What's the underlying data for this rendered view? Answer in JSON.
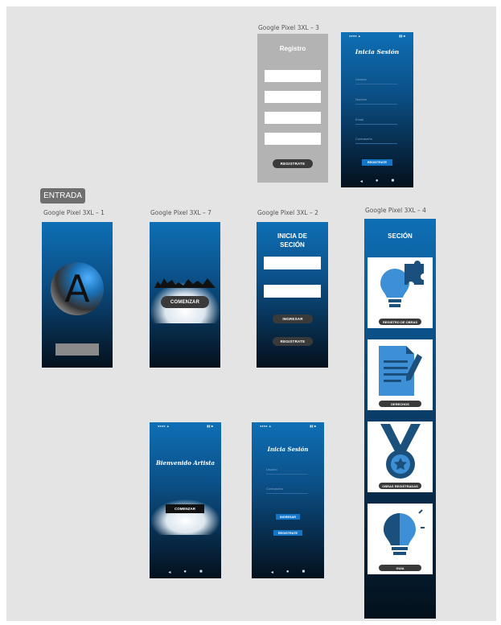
{
  "labels": {
    "pixel1": "Google Pixel 3XL – 1",
    "pixel7": "Google Pixel 3XL – 7",
    "pixel2": "Google Pixel 3XL – 2",
    "pixel4": "Google Pixel 3XL – 4",
    "pixel3": "Google Pixel 3XL – 3"
  },
  "entrada": "ENTRADA",
  "artboard1": {
    "logo_letter": "A"
  },
  "artboard7": {
    "button": "COMENZAR"
  },
  "artboard2": {
    "title_line1": "INICIA DE",
    "title_line2": "SECIÓN",
    "btn_ingresar": "INGRESAR",
    "btn_registrate": "REGISTRATE"
  },
  "artboard3": {
    "title": "Registro",
    "btn_registrate": "REGISTRATE"
  },
  "artboardTop": {
    "title": "Inicia Sesión",
    "f1": "Usuario",
    "f2": "Nombre",
    "f3": "Email",
    "f4": "Contraseña",
    "btn": "REGISTRATE"
  },
  "artboard4": {
    "title": "SECIÓN",
    "cards": [
      "REGISTRO DE OBRAS",
      "DERECHOS",
      "OBRAS REGISTRADAS",
      "GUIA"
    ]
  },
  "artboardBL": {
    "title": "Bienvenido Artista",
    "btn": "COMENZAR"
  },
  "artboardBR": {
    "title": "Inicia Sesión",
    "f1": "Usuario",
    "f2": "Contraseña",
    "btn1": "INGRESAR",
    "btn2": "REGISTRATE"
  },
  "colors": {
    "accent_blue": "#0e6fb5",
    "canvas": "#e4e4e4"
  }
}
